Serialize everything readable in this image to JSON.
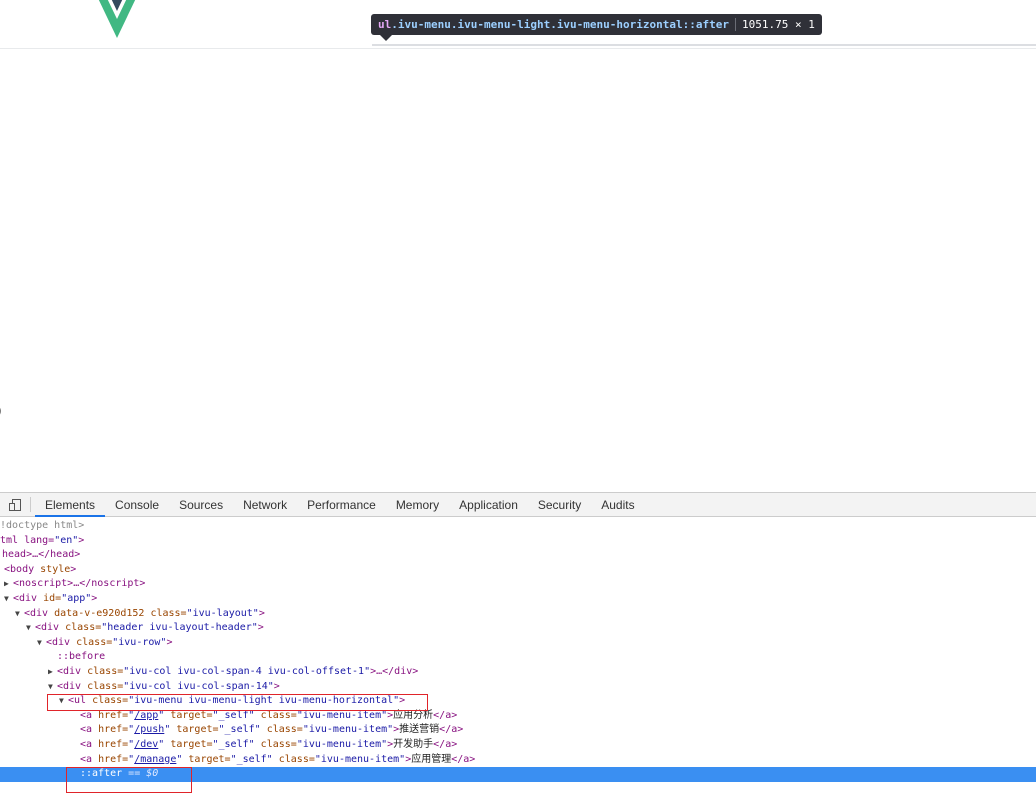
{
  "tooltip": {
    "tag": "ul",
    "classes": ".ivu-menu.ivu-menu-light.ivu-menu-horizontal::after",
    "dims": "1051.75 × 1"
  },
  "logo": {
    "name": "vue-logo",
    "colors": {
      "outer": "#41b883",
      "inner": "#34495e"
    }
  },
  "devtools": {
    "tabs": [
      "Elements",
      "Console",
      "Sources",
      "Network",
      "Performance",
      "Memory",
      "Application",
      "Security",
      "Audits"
    ],
    "active_tab": "Elements",
    "accent": "#1a73e8",
    "selection_color": "#3a8ff2",
    "highlight_color": "#e0242a"
  },
  "dom": {
    "doctype": "!doctype html>",
    "html_open": "tml lang=",
    "html_lang": "\"en\"",
    "head": "head>…</head>",
    "body_tag": "body",
    "body_attr": "style",
    "noscript": "<noscript>…</noscript>",
    "app": {
      "tag": "<div",
      "attr": " id=",
      "val": "\"app\"",
      "close": ">"
    },
    "layout": {
      "tag": "<div",
      "attr1": " data-v-e920d152 class=",
      "val": "\"ivu-layout\"",
      "close": ">"
    },
    "header": {
      "tag": "<div",
      "attr": " class=",
      "val": "\"header ivu-layout-header\"",
      "close": ">"
    },
    "row": {
      "tag": "<div",
      "attr": " class=",
      "val": "\"ivu-row\"",
      "close": ">"
    },
    "before": "::before",
    "col1": {
      "tag": "<div",
      "attr": " class=",
      "val": "\"ivu-col ivu-col-span-4 ivu-col-offset-1\"",
      "close": ">…</div>"
    },
    "col2": {
      "tag": "<div",
      "attr": " class=",
      "val": "\"ivu-col ivu-col-span-14\"",
      "close": ">"
    },
    "ul": {
      "tag": "<ul",
      "attr": " class=",
      "val": "\"ivu-menu ivu-menu-light ivu-menu-horizontal\"",
      "close": ">"
    },
    "items": [
      {
        "href": "/app",
        "text": "应用分析"
      },
      {
        "href": "/push",
        "text": "推送营销"
      },
      {
        "href": "/dev",
        "text": "开发助手"
      },
      {
        "href": "/manage",
        "text": "应用管理"
      }
    ],
    "a_tag": "<a",
    "a_href": " href=",
    "a_target": " target=",
    "a_target_val": "\"_self\"",
    "a_class": " class=",
    "a_class_val": "\"ivu-menu-item\"",
    "a_close": "</a>",
    "after": "::after",
    "after_eq": " == $0"
  }
}
